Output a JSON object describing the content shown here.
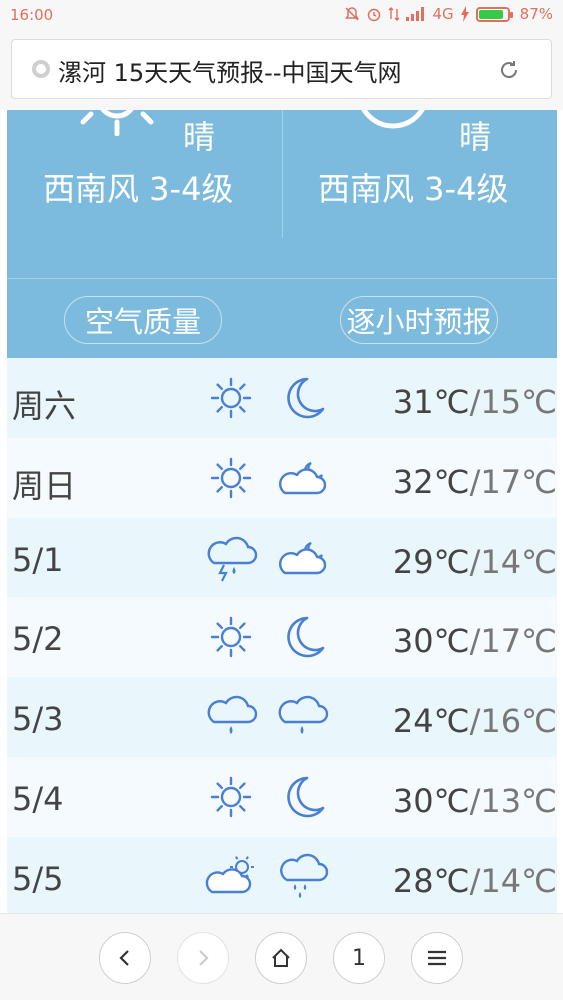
{
  "status_bar": {
    "time": "16:00",
    "network": "4G",
    "battery": "87%",
    "battery_level": 0.87
  },
  "browser": {
    "page_title": "漯河 15天天气预报--中国天气网"
  },
  "today": {
    "day": {
      "condition": "晴",
      "wind": "西南风 3-4级",
      "icon": "sun-icon"
    },
    "night": {
      "condition": "晴",
      "wind": "西南风 3-4级",
      "icon": "moon-icon"
    },
    "air_quality_button": "空气质量",
    "hourly_button": "逐小时预报"
  },
  "forecast": [
    {
      "day": "周六",
      "day_icon": "sun",
      "night_icon": "moon",
      "high": "31℃",
      "sep": "/",
      "low": "15℃"
    },
    {
      "day": "周日",
      "day_icon": "sun",
      "night_icon": "cloud-moon",
      "high": "32℃",
      "sep": "/",
      "low": "17℃"
    },
    {
      "day": "5/1",
      "day_icon": "thunderstorm",
      "night_icon": "cloud-moon",
      "high": "29℃",
      "sep": "/",
      "low": "14℃"
    },
    {
      "day": "5/2",
      "day_icon": "sun",
      "night_icon": "moon",
      "high": "30℃",
      "sep": "/",
      "low": "17℃"
    },
    {
      "day": "5/3",
      "day_icon": "rain",
      "night_icon": "rain",
      "high": "24℃",
      "sep": "/",
      "low": "16℃"
    },
    {
      "day": "5/4",
      "day_icon": "sun",
      "night_icon": "moon",
      "high": "30℃",
      "sep": "/",
      "low": "13℃"
    },
    {
      "day": "5/5",
      "day_icon": "cloud-sun",
      "night_icon": "heavy-rain",
      "high": "28℃",
      "sep": "/",
      "low": "14℃"
    }
  ],
  "bottom_nav": {
    "tab_count": "1"
  },
  "colors": {
    "hero_bg": "#7cbbde",
    "icon_blue": "#4a7fd1",
    "row_odd": "#e9f6fc",
    "row_even": "#f4fafd",
    "status_red": "#e0705c"
  }
}
